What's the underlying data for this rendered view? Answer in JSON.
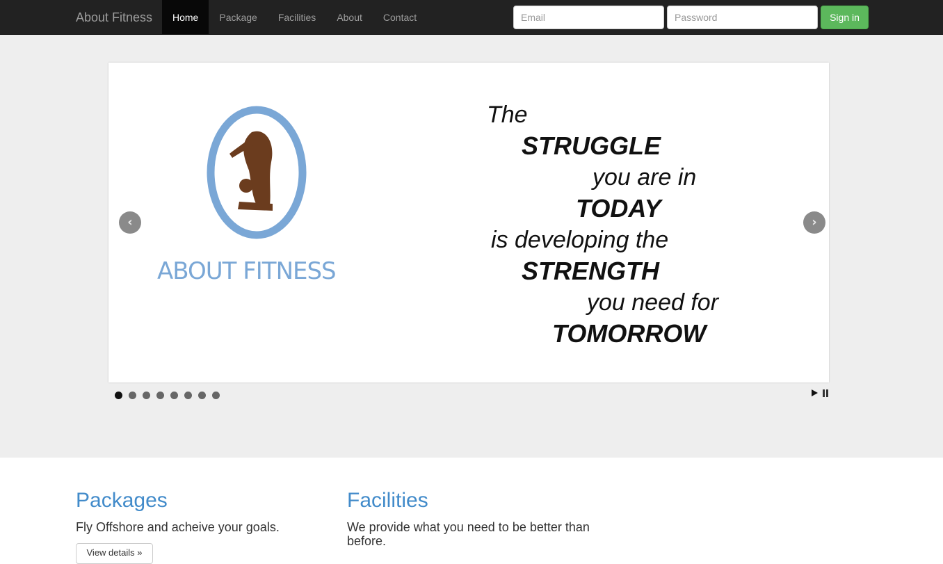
{
  "navbar": {
    "brand": "About Fitness",
    "items": [
      {
        "label": "Home",
        "active": true
      },
      {
        "label": "Package",
        "active": false
      },
      {
        "label": "Facilities",
        "active": false
      },
      {
        "label": "About",
        "active": false
      },
      {
        "label": "Contact",
        "active": false
      }
    ],
    "email_placeholder": "Email",
    "password_placeholder": "Password",
    "signin_label": "Sign in"
  },
  "carousel": {
    "logo_text": "ABOUT FITNESS",
    "quote_lines": [
      "The",
      "STRUGGLE",
      "you are in",
      "TODAY",
      "is developing the",
      "STRENGTH",
      "you need for",
      "TOMORROW"
    ],
    "prev_icon": "chevron-left-icon",
    "next_icon": "chevron-right-icon",
    "slide_count": 8,
    "active_index": 0
  },
  "features": [
    {
      "title": "Packages",
      "text": "Fly Offshore and acheive your goals.",
      "button": "View details »"
    },
    {
      "title": "Facilities",
      "text": "We provide what you need to be better than before."
    }
  ],
  "colors": {
    "navbar": "#222222",
    "link": "#428bca",
    "success": "#5cb85c",
    "logo_blue": "#7aa7d6",
    "figure_brown": "#6b3c1e"
  }
}
